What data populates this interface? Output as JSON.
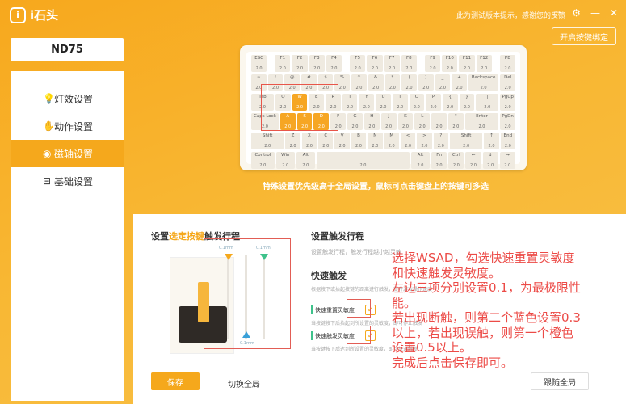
{
  "app": {
    "logo_text": "i石头",
    "top_notice": "此为测试版本提示，感谢您的反馈",
    "bind_button": "开启按键绑定"
  },
  "device": {
    "name": "ND75"
  },
  "sidebar": {
    "items": [
      {
        "label": "灯效设置",
        "icon": "bulb-icon"
      },
      {
        "label": "动作设置",
        "icon": "hand-icon"
      },
      {
        "label": "磁轴设置",
        "icon": "magnet-icon",
        "active": true
      },
      {
        "label": "基础设置",
        "icon": "settings-icon"
      }
    ]
  },
  "keyboard": {
    "hint": "特殊设置优先级高于全局设置，鼠标可点击键盘上的按键可多选",
    "rows": [
      [
        "ESC",
        "",
        "F1",
        "F2",
        "F3",
        "F4",
        "",
        "F5",
        "F6",
        "F7",
        "F8",
        "",
        "F9",
        "F10",
        "F11",
        "F12",
        "",
        "PB"
      ],
      [
        "~",
        "!",
        "@",
        "#",
        "$",
        "%",
        "^",
        "&",
        "*",
        "(",
        ")",
        "_",
        "+",
        "Backspace",
        "Del"
      ],
      [
        "Tab",
        "Q",
        "W",
        "E",
        "R",
        "T",
        "Y",
        "U",
        "I",
        "O",
        "P",
        "{",
        "}",
        "|",
        "PgUp"
      ],
      [
        "Caps Lock",
        "A",
        "S",
        "D",
        "F",
        "G",
        "H",
        "J",
        "K",
        "L",
        ":",
        "\"",
        "Enter",
        "PgDn"
      ],
      [
        "Shift",
        "Z",
        "X",
        "C",
        "V",
        "B",
        "N",
        "M",
        "<",
        ">",
        "?",
        "Shift",
        "↑",
        "End"
      ],
      [
        "Control",
        "Win",
        "Alt",
        "",
        "Alt",
        "Fn",
        "Ctrl",
        "←",
        "↓",
        "→"
      ]
    ],
    "value": "2.0",
    "selected": [
      "W",
      "A",
      "S",
      "D"
    ]
  },
  "panel": {
    "left_title_prefix": "设置",
    "left_title_hl": "选定按键",
    "left_title_suffix": "触发行程",
    "slider_values": [
      "0.1mm",
      "0.1mm",
      "0.1mm"
    ],
    "save_button": "保存",
    "switch_global": "切换全局",
    "right_title": "设置触发行程",
    "right_sub": "设置触发行程，触发行程越小越灵敏",
    "quick_title": "快速触发",
    "quick_desc": "根据按下或抬起按键的距离进行触发，提升游戏操作速度",
    "opt1_label": "快速重置灵敏度",
    "opt1_desc": "当按键按下后抬起到所设置的灵敏度，即可停止触发",
    "opt2_label": "快速触发灵敏度",
    "opt2_desc": "当按键按下后达到所设置的灵敏度，即可快速触发",
    "follow_global": "跟随全局"
  },
  "annotation": {
    "lines": [
      "选择WSAD，勾选快速重置灵敏度",
      "和快速触发灵敏度。",
      "左边三项分别设置0.1，为最极限性",
      "能。",
      "若出现断触，则第二个蓝色设置0.3",
      "以上，若出现误触，则第一个橙色",
      "设置0.5以上。",
      "完成后点击保存即可。"
    ]
  },
  "colors": {
    "accent": "#f5a81c",
    "annotation": "#ec4b47",
    "green": "#3ec28b",
    "blue": "#3aa0d8"
  }
}
